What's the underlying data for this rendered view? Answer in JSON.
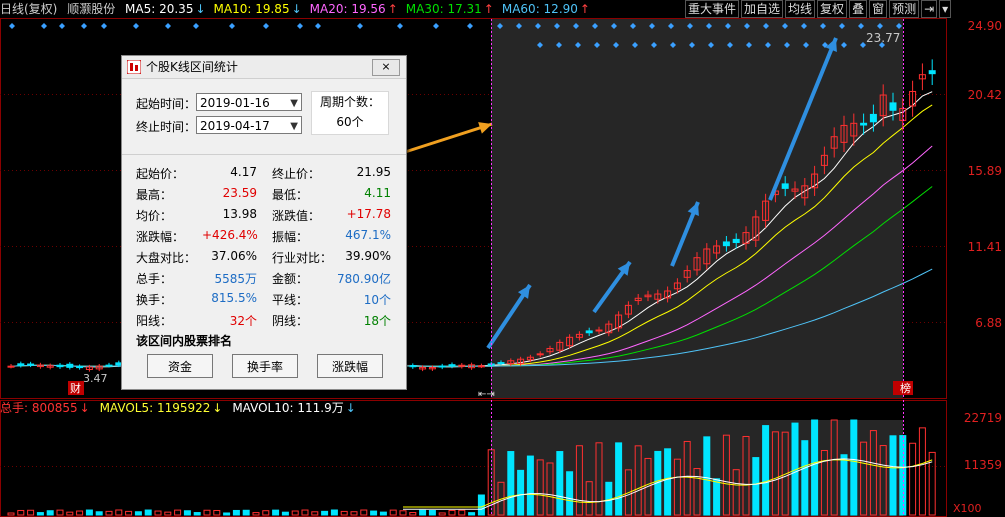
{
  "header": {
    "period_label": "日线(复权)",
    "stock_name": "顺灏股份",
    "ma": [
      {
        "label": "MA5: 20.35",
        "dir": "↓",
        "color": "#ffffff"
      },
      {
        "label": "MA10: 19.85",
        "dir": "↓",
        "color": "#ffff00"
      },
      {
        "label": "MA20: 19.56",
        "dir": "↑",
        "color": "#ff66ff"
      },
      {
        "label": "MA30: 17.31",
        "dir": "↑",
        "color": "#00e000"
      },
      {
        "label": "MA60: 12.90",
        "dir": "↑",
        "color": "#4fc3f7"
      }
    ]
  },
  "menu": {
    "items": [
      "重大事件",
      "加自选",
      "均线",
      "复权",
      "叠",
      "窗",
      "预测"
    ],
    "arrow_label": "⇥",
    "dropdown_label": "▾"
  },
  "price_axis": [
    "24.90",
    "20.42",
    "15.89",
    "11.41",
    "6.88"
  ],
  "chart_labels": {
    "high_mark": "23.77",
    "low_mark": "3.47",
    "cai_badge": "财",
    "bang_badge": "榜"
  },
  "volume": {
    "header": {
      "total_label": "总手: 800855",
      "total_dir": "↓",
      "vol5_label": "MAVOL5: 1195922",
      "vol5_dir": "↓",
      "vol10_label": "MAVOL10: 111.9万",
      "vol10_dir": "↓"
    },
    "axis": [
      "22719",
      "11359"
    ],
    "unit": "X100"
  },
  "dialog": {
    "title": "个股K线区间统计",
    "close_label": "⨯",
    "start_label": "起始时间：",
    "start_value": "2019-01-16",
    "end_label": "终止时间：",
    "end_value": "2019-04-17",
    "period_label": "周期个数：",
    "period_value": "60个",
    "stats": [
      {
        "l1": "起始价：",
        "v1": "4.17",
        "c1": "",
        "l2": "终止价：",
        "v2": "21.95",
        "c2": ""
      },
      {
        "l1": "最高：",
        "v1": "23.59",
        "c1": "red",
        "l2": "最低：",
        "v2": "4.11",
        "c2": "green"
      },
      {
        "l1": "均价：",
        "v1": "13.98",
        "c1": "",
        "l2": "涨跌值：",
        "v2": "+17.78",
        "c2": "red"
      },
      {
        "l1": "涨跌幅：",
        "v1": "+426.4%",
        "c1": "red",
        "l2": "振幅：",
        "v2": "467.1%",
        "c2": "blue"
      },
      {
        "l1": "大盘对比：",
        "v1": "37.06%",
        "c1": "",
        "l2": "行业对比：",
        "v2": "39.90%",
        "c2": ""
      },
      {
        "l1": "总手：",
        "v1": "5585万",
        "c1": "blue",
        "l2": "金额：",
        "v2": "780.90亿",
        "c2": "blue"
      },
      {
        "l1": "换手：",
        "v1": "815.5%",
        "c1": "blue",
        "l2": "平线：",
        "v2": "10个",
        "c2": "blue"
      },
      {
        "l1": "阳线：",
        "v1": "32个",
        "c1": "red",
        "l2": "阴线：",
        "v2": "18个",
        "c2": "green"
      }
    ],
    "rank_title": "该区间内股票排名",
    "buttons": [
      "资金",
      "换手率",
      "涨跌幅"
    ]
  }
}
